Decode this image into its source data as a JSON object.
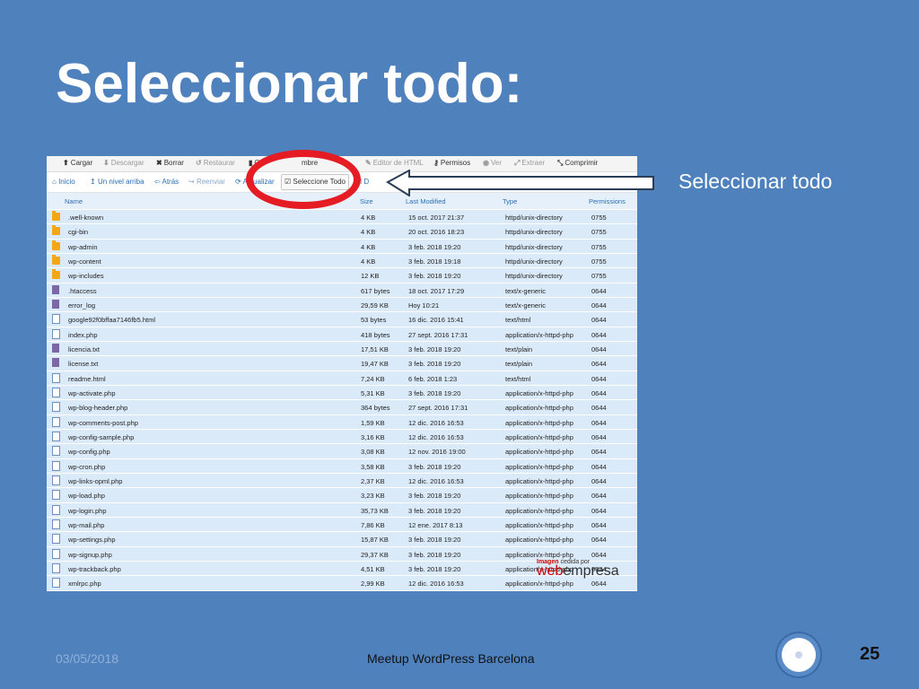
{
  "slide": {
    "title": "Seleccionar todo:",
    "callout": "Seleccionar todo",
    "date": "03/05/2018",
    "footer": "Meetup WordPress Barcelona",
    "page": "25"
  },
  "toolbar": [
    {
      "icon": "upload-icon",
      "glyph": "⬆",
      "label": "Cargar",
      "disabled": false
    },
    {
      "icon": "download-icon",
      "glyph": "⬇",
      "label": "Descargar",
      "disabled": true
    },
    {
      "icon": "delete-icon",
      "glyph": "✖",
      "label": "Borrar",
      "disabled": false
    },
    {
      "icon": "restore-icon",
      "glyph": "↺",
      "label": "Restaurar",
      "disabled": true
    },
    {
      "icon": "rename-icon",
      "glyph": "▮",
      "label": "C",
      "disabled": false
    },
    {
      "icon": "rename-tail",
      "glyph": "",
      "label": "mbre",
      "disabled": false
    },
    {
      "icon": "html-editor-icon",
      "glyph": "✎",
      "label": "Editor de HTML",
      "disabled": true
    },
    {
      "icon": "key-icon",
      "glyph": "⚷",
      "label": "Permisos",
      "disabled": false
    },
    {
      "icon": "eye-icon",
      "glyph": "◉",
      "label": "Ver",
      "disabled": true
    },
    {
      "icon": "extract-icon",
      "glyph": "⤢",
      "label": "Extraer",
      "disabled": true
    },
    {
      "icon": "compress-icon",
      "glyph": "⤡",
      "label": "Comprimir",
      "disabled": false
    }
  ],
  "nav": [
    {
      "icon": "home-icon",
      "glyph": "⌂",
      "label": "Inicio"
    },
    {
      "icon": "up-level-icon",
      "glyph": "↥",
      "label": "Un nivel arriba"
    },
    {
      "icon": "back-icon",
      "glyph": "⇦",
      "label": "Atrás"
    },
    {
      "icon": "forward-icon",
      "glyph": "↪",
      "label": "Reenviar"
    },
    {
      "icon": "refresh-icon",
      "glyph": "⟳",
      "label": "Actualizar"
    },
    {
      "icon": "select-all-icon",
      "glyph": "☑",
      "label": "Seleccione Todo"
    },
    {
      "icon": "deselect-icon",
      "glyph": "☐",
      "label": "D"
    }
  ],
  "columns": [
    "Name",
    "Size",
    "Last Modified",
    "Type",
    "Permissions"
  ],
  "files": [
    {
      "kind": "folder",
      "name": ".well-known",
      "size": "4 KB",
      "modified": "15 oct. 2017 21:37",
      "type": "httpd/unix-directory",
      "perm": "0755"
    },
    {
      "kind": "folder",
      "name": "cgi-bin",
      "size": "4 KB",
      "modified": "20 oct. 2016 18:23",
      "type": "httpd/unix-directory",
      "perm": "0755"
    },
    {
      "kind": "folder",
      "name": "wp-admin",
      "size": "4 KB",
      "modified": "3 feb. 2018 19:20",
      "type": "httpd/unix-directory",
      "perm": "0755"
    },
    {
      "kind": "folder",
      "name": "wp-content",
      "size": "4 KB",
      "modified": "3 feb. 2018 19:18",
      "type": "httpd/unix-directory",
      "perm": "0755"
    },
    {
      "kind": "folder",
      "name": "wp-includes",
      "size": "12 KB",
      "modified": "3 feb. 2018 19:20",
      "type": "httpd/unix-directory",
      "perm": "0755"
    },
    {
      "kind": "text",
      "name": ".htaccess",
      "size": "617 bytes",
      "modified": "18 oct. 2017 17:29",
      "type": "text/x-generic",
      "perm": "0644"
    },
    {
      "kind": "text",
      "name": "error_log",
      "size": "29,59 KB",
      "modified": "Hoy 10:21",
      "type": "text/x-generic",
      "perm": "0644"
    },
    {
      "kind": "code",
      "name": "google92f0bffaa7146fb5.html",
      "size": "53 bytes",
      "modified": "16 dic. 2016 15:41",
      "type": "text/html",
      "perm": "0644"
    },
    {
      "kind": "code",
      "name": "index.php",
      "size": "418 bytes",
      "modified": "27 sept. 2016 17:31",
      "type": "application/x-httpd-php",
      "perm": "0644"
    },
    {
      "kind": "text",
      "name": "licencia.txt",
      "size": "17,51 KB",
      "modified": "3 feb. 2018 19:20",
      "type": "text/plain",
      "perm": "0644"
    },
    {
      "kind": "text",
      "name": "license.txt",
      "size": "19,47 KB",
      "modified": "3 feb. 2018 19:20",
      "type": "text/plain",
      "perm": "0644"
    },
    {
      "kind": "code",
      "name": "readme.html",
      "size": "7,24 KB",
      "modified": "6 feb. 2018 1:23",
      "type": "text/html",
      "perm": "0644"
    },
    {
      "kind": "code",
      "name": "wp-activate.php",
      "size": "5,31 KB",
      "modified": "3 feb. 2018 19:20",
      "type": "application/x-httpd-php",
      "perm": "0644"
    },
    {
      "kind": "code",
      "name": "wp-blog-header.php",
      "size": "364 bytes",
      "modified": "27 sept. 2016 17:31",
      "type": "application/x-httpd-php",
      "perm": "0644"
    },
    {
      "kind": "code",
      "name": "wp-comments-post.php",
      "size": "1,59 KB",
      "modified": "12 dic. 2016 16:53",
      "type": "application/x-httpd-php",
      "perm": "0644"
    },
    {
      "kind": "code",
      "name": "wp-config-sample.php",
      "size": "3,16 KB",
      "modified": "12 dic. 2016 16:53",
      "type": "application/x-httpd-php",
      "perm": "0644"
    },
    {
      "kind": "code",
      "name": "wp-config.php",
      "size": "3,08 KB",
      "modified": "12 nov. 2016 19:00",
      "type": "application/x-httpd-php",
      "perm": "0644"
    },
    {
      "kind": "code",
      "name": "wp-cron.php",
      "size": "3,58 KB",
      "modified": "3 feb. 2018 19:20",
      "type": "application/x-httpd-php",
      "perm": "0644"
    },
    {
      "kind": "code",
      "name": "wp-links-opml.php",
      "size": "2,37 KB",
      "modified": "12 dic. 2016 16:53",
      "type": "application/x-httpd-php",
      "perm": "0644"
    },
    {
      "kind": "code",
      "name": "wp-load.php",
      "size": "3,23 KB",
      "modified": "3 feb. 2018 19:20",
      "type": "application/x-httpd-php",
      "perm": "0644"
    },
    {
      "kind": "code",
      "name": "wp-login.php",
      "size": "35,73 KB",
      "modified": "3 feb. 2018 19:20",
      "type": "application/x-httpd-php",
      "perm": "0644"
    },
    {
      "kind": "code",
      "name": "wp-mail.php",
      "size": "7,86 KB",
      "modified": "12 ene. 2017 8:13",
      "type": "application/x-httpd-php",
      "perm": "0644"
    },
    {
      "kind": "code",
      "name": "wp-settings.php",
      "size": "15,87 KB",
      "modified": "3 feb. 2018 19:20",
      "type": "application/x-httpd-php",
      "perm": "0644"
    },
    {
      "kind": "code",
      "name": "wp-signup.php",
      "size": "29,37 KB",
      "modified": "3 feb. 2018 19:20",
      "type": "application/x-httpd-php",
      "perm": "0644"
    },
    {
      "kind": "code",
      "name": "wp-trackback.php",
      "size": "4,51 KB",
      "modified": "3 feb. 2018 19:20",
      "type": "application/x-httpd-php",
      "perm": "0644"
    },
    {
      "kind": "code",
      "name": "xmlrpc.php",
      "size": "2,99 KB",
      "modified": "12 dic. 2016 16:53",
      "type": "application/x-httpd-php",
      "perm": "0644"
    }
  ],
  "watermark": {
    "top": "Imagen",
    "top2": "cedida por",
    "web": "web",
    "empresa": "empresa"
  }
}
